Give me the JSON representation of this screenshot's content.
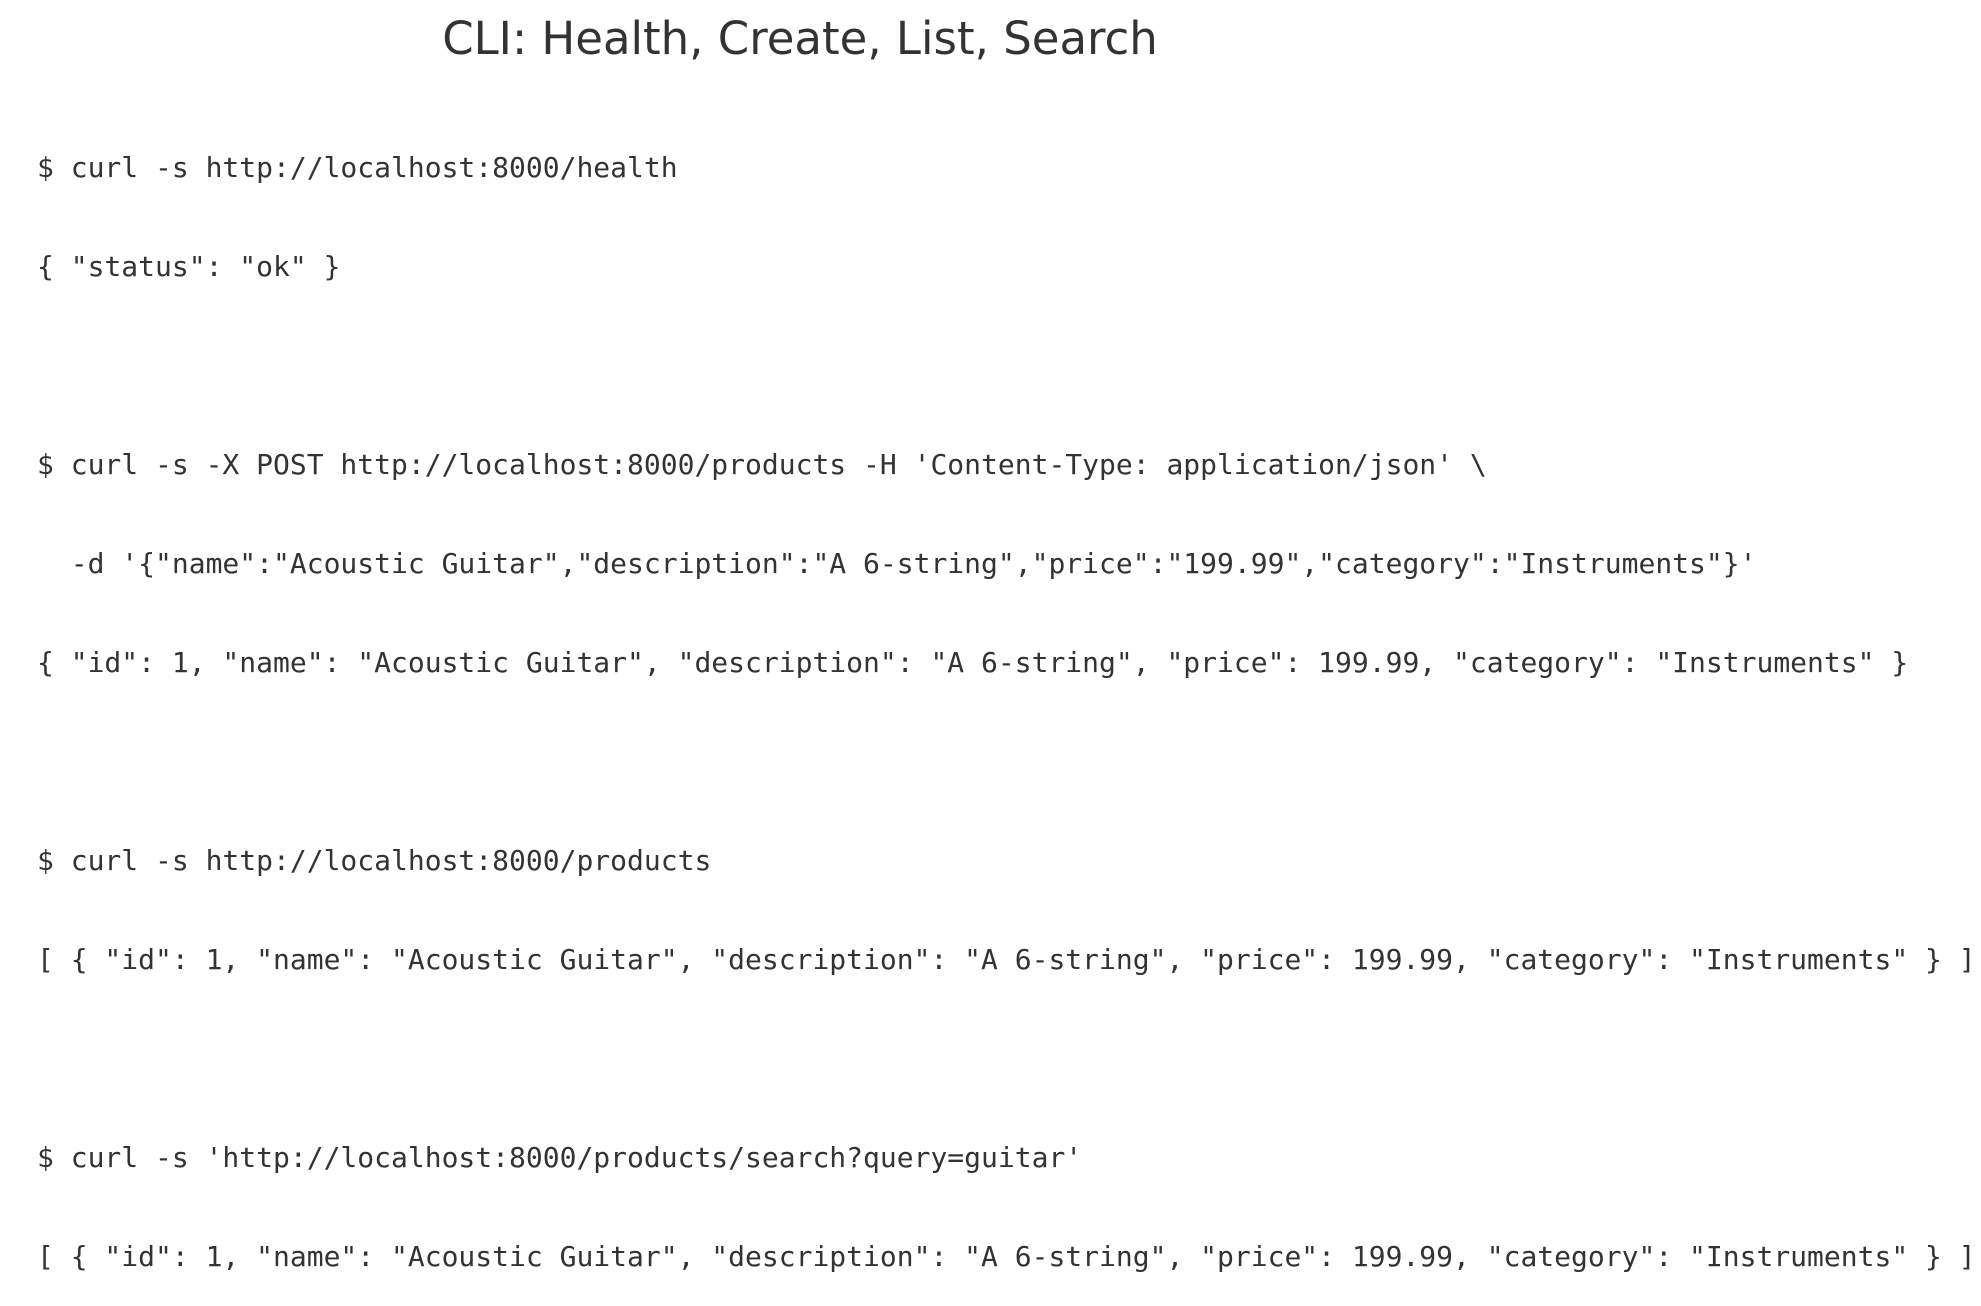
{
  "title": "CLI: Health, Create, List, Search",
  "lines": [
    "$ curl -s http://localhost:8000/health",
    "{ \"status\": \"ok\" }",
    "$ curl -s -X POST http://localhost:8000/products -H 'Content-Type: application/json' \\",
    "  -d '{\"name\":\"Acoustic Guitar\",\"description\":\"A 6-string\",\"price\":\"199.99\",\"category\":\"Instruments\"}'",
    "{ \"id\": 1, \"name\": \"Acoustic Guitar\", \"description\": \"A 6-string\", \"price\": 199.99, \"category\": \"Instruments\" }",
    "$ curl -s http://localhost:8000/products",
    "[ { \"id\": 1, \"name\": \"Acoustic Guitar\", \"description\": \"A 6-string\", \"price\": 199.99, \"category\": \"Instruments\" } ]",
    "$ curl -s 'http://localhost:8000/products/search?query=guitar'",
    "[ { \"id\": 1, \"name\": \"Acoustic Guitar\", \"description\": \"A 6-string\", \"price\": 199.99, \"category\": \"Instruments\" } ]"
  ]
}
